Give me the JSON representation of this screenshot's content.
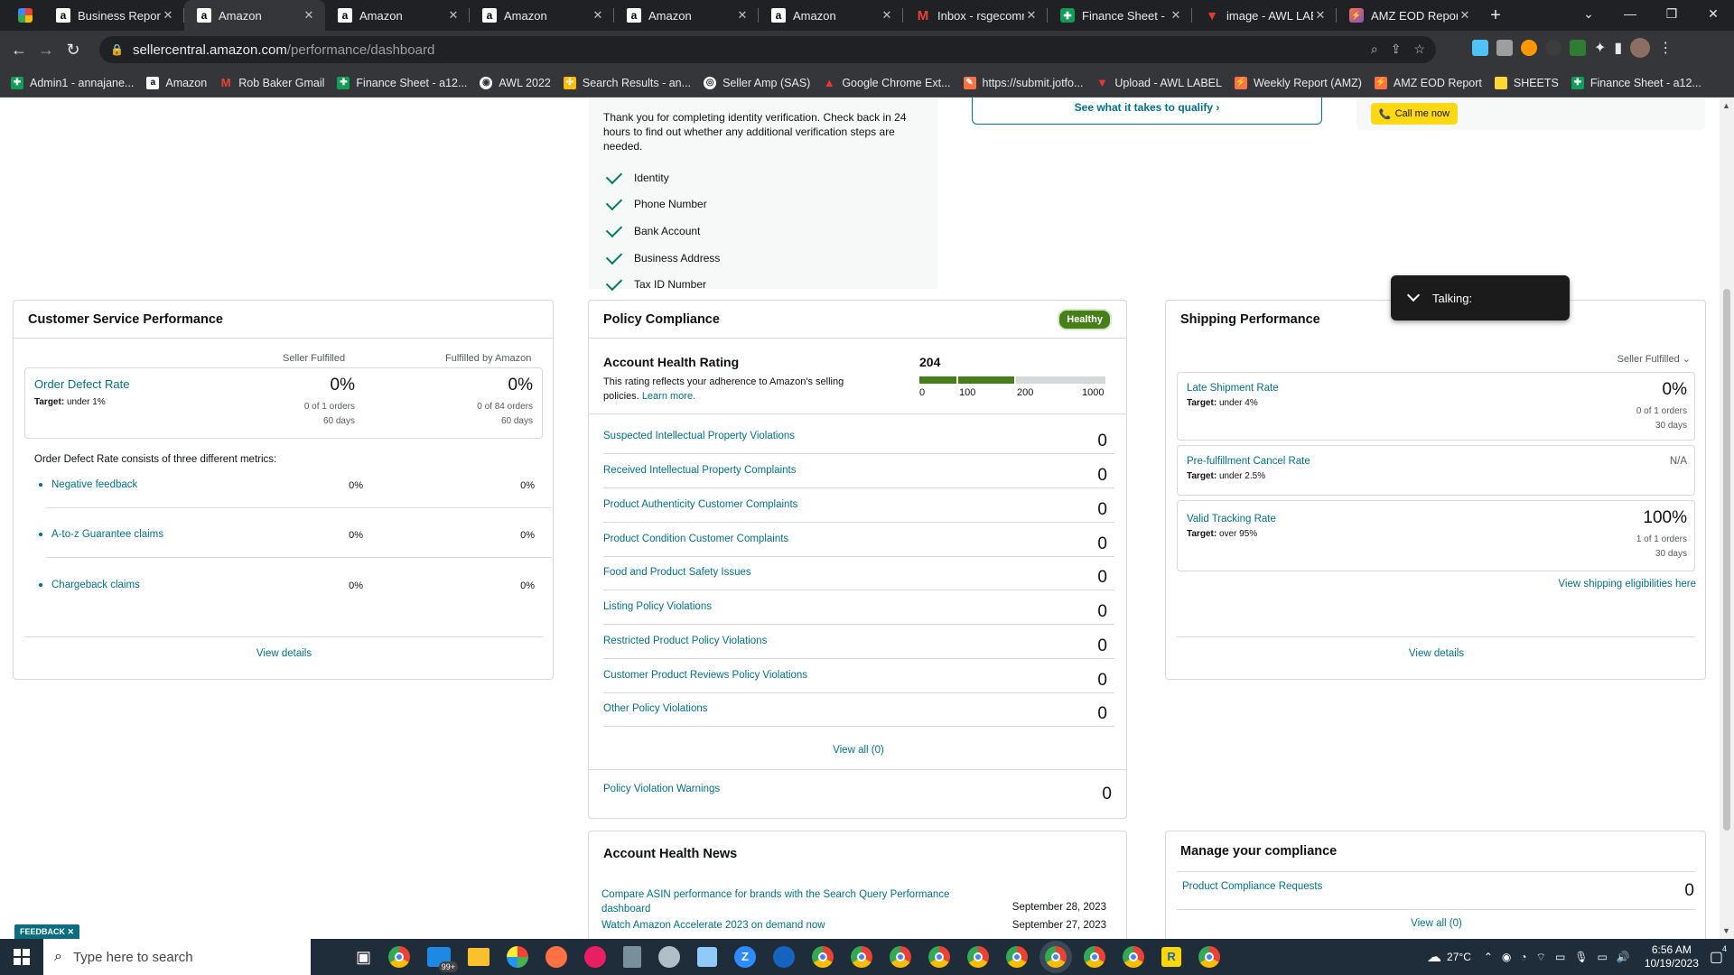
{
  "browser": {
    "tabs": [
      {
        "label": "Business Reports",
        "icon": "seller-central-icon",
        "active": false
      },
      {
        "label": "Amazon",
        "icon": "amazon-icon",
        "active": true
      },
      {
        "label": "Amazon",
        "icon": "amazon-icon",
        "active": false
      },
      {
        "label": "Amazon",
        "icon": "amazon-icon",
        "active": false
      },
      {
        "label": "Amazon",
        "icon": "amazon-icon",
        "active": false
      },
      {
        "label": "Amazon",
        "icon": "amazon-icon",
        "active": false
      },
      {
        "label": "Inbox - rsgecomm",
        "icon": "gmail-icon",
        "active": false
      },
      {
        "label": "Finance Sheet - a",
        "icon": "sheets-icon",
        "active": false
      },
      {
        "label": "image - AWL LAB",
        "icon": "awl-icon",
        "active": false
      },
      {
        "label": "AMZ EOD Report",
        "icon": "eod-icon",
        "active": false
      }
    ],
    "url_host": "sellercentral.amazon.com",
    "url_path": "/performance/dashboard",
    "bookmarks": [
      {
        "label": "Admin1 - annajane...",
        "icon": "g"
      },
      {
        "label": "Amazon",
        "icon": "a"
      },
      {
        "label": "Rob Baker Gmail",
        "icon": "m"
      },
      {
        "label": "Finance Sheet - a12...",
        "icon": "g"
      },
      {
        "label": "AWL 2022",
        "icon": "w"
      },
      {
        "label": "Search Results - an...",
        "icon": "s"
      },
      {
        "label": "Seller Amp (SAS)",
        "icon": "o"
      },
      {
        "label": "Google Chrome Ext...",
        "icon": "r"
      },
      {
        "label": "https://submit.jotfo...",
        "icon": "o"
      },
      {
        "label": "Upload - AWL LABEL",
        "icon": "r"
      },
      {
        "label": "Weekly Report (AMZ)",
        "icon": "o"
      },
      {
        "label": "AMZ EOD Report",
        "icon": "o"
      },
      {
        "label": "SHEETS",
        "icon": "y"
      },
      {
        "label": "Finance Sheet - a12...",
        "icon": "g"
      }
    ]
  },
  "verification": {
    "message": "Thank you for completing identity verification. Check back in 24 hours to find out whether any additional verification steps are needed.",
    "items": [
      "Identity",
      "Phone Number",
      "Bank Account",
      "Business Address",
      "Tax ID Number"
    ]
  },
  "qualify_link": "See what it takes to qualify",
  "call_button": "Call me now",
  "toast": "Talking:",
  "customer_service": {
    "title": "Customer Service Performance",
    "col_seller": "Seller Fulfilled",
    "col_fba": "Fulfilled by Amazon",
    "odr_label": "Order Defect Rate",
    "odr_target_label": "Target:",
    "odr_target": "under 1%",
    "seller_pct": "0%",
    "seller_orders": "0 of 1 orders",
    "seller_days": "60 days",
    "fba_pct": "0%",
    "fba_orders": "0 of 84 orders",
    "fba_days": "60 days",
    "consists": "Order Defect Rate consists of three different metrics:",
    "metrics": [
      {
        "label": "Negative feedback",
        "seller": "0%",
        "fba": "0%"
      },
      {
        "label": "A-to-z Guarantee claims",
        "seller": "0%",
        "fba": "0%"
      },
      {
        "label": "Chargeback claims",
        "seller": "0%",
        "fba": "0%"
      }
    ],
    "view_details": "View details"
  },
  "policy": {
    "title": "Policy Compliance",
    "badge": "Healthy",
    "ahr_title": "Account Health Rating",
    "ahr_desc": "This rating reflects your adherence to Amazon's selling policies.",
    "learn_more": "Learn more.",
    "score": 204,
    "bar_ticks": [
      "0",
      "100",
      "200",
      "1000"
    ],
    "violations": [
      {
        "label": "Suspected Intellectual Property Violations",
        "count": "0"
      },
      {
        "label": "Received Intellectual Property Complaints",
        "count": "0"
      },
      {
        "label": "Product Authenticity Customer Complaints",
        "count": "0"
      },
      {
        "label": "Product Condition Customer Complaints",
        "count": "0"
      },
      {
        "label": "Food and Product Safety Issues",
        "count": "0"
      },
      {
        "label": "Listing Policy Violations",
        "count": "0"
      },
      {
        "label": "Restricted Product Policy Violations",
        "count": "0"
      },
      {
        "label": "Customer Product Reviews Policy Violations",
        "count": "0"
      },
      {
        "label": "Other Policy Violations",
        "count": "0"
      }
    ],
    "view_all": "View all (0)",
    "warnings_label": "Policy Violation Warnings",
    "warnings_count": "0"
  },
  "shipping": {
    "title": "Shipping Performance",
    "filter": "Seller Fulfilled",
    "late_label": "Late Shipment Rate",
    "late_target": "under 4%",
    "late_pct": "0%",
    "late_orders": "0 of 1 orders",
    "late_days": "30 days",
    "cancel_label": "Pre-fulfillment Cancel Rate",
    "cancel_target": "under 2.5%",
    "cancel_value": "N/A",
    "vtr_label": "Valid Tracking Rate",
    "vtr_target": "over 95%",
    "vtr_pct": "100%",
    "vtr_orders": "1 of 1 orders",
    "vtr_days": "30 days",
    "eligibility": "View shipping eligibilities here",
    "view_details": "View details"
  },
  "news": {
    "title": "Account Health News",
    "items": [
      {
        "label": "Compare ASIN performance for brands with the Search Query Performance dashboard",
        "date": "September 28, 2023"
      },
      {
        "label": "Watch Amazon Accelerate 2023 on demand now",
        "date": "September 27, 2023"
      }
    ]
  },
  "compliance": {
    "title": "Manage your compliance",
    "requests_label": "Product Compliance Requests",
    "requests_count": "0",
    "view_all": "View all (0)"
  },
  "feedback": "FEEDBACK",
  "taskbar": {
    "search_placeholder": "Type here to search",
    "badge_count": "99+",
    "weather": "27°C",
    "time": "6:56 AM",
    "date": "10/19/2023",
    "notif_count": "4"
  },
  "colors": {
    "link": "#007185",
    "healthy": "#467f1a",
    "call_button": "#ffd814"
  }
}
